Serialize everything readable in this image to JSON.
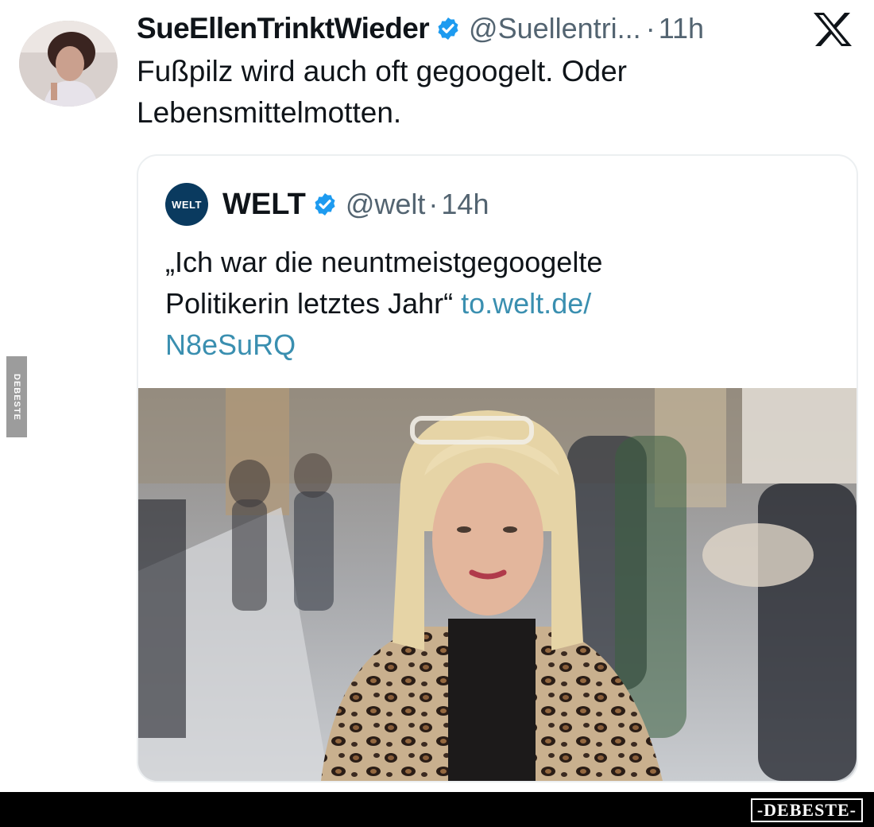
{
  "tweet": {
    "author_name": "SueEllenTrinktWieder",
    "handle": "@Suellentri...",
    "separator": "·",
    "time": "11h",
    "text_line1": "Fußpilz wird auch oft gegoogelt. Oder",
    "text_line2": "Lebensmittelmotten.",
    "avatar_icon": "profile-photo",
    "platform_icon": "x-logo-icon"
  },
  "quote": {
    "logo_text": "WELT",
    "author_name": "WELT",
    "handle": "@welt",
    "separator": "·",
    "time": "14h",
    "text_line1": "„Ich war die neuntmeistgegoogelte",
    "text_line2_plain": "Politikerin letztes Jahr“ ",
    "link_part1": "to.welt.de/",
    "link_part2": "N8eSuRQ",
    "image_icon": "article-photo"
  },
  "watermark": {
    "side_label": "DEBESTE",
    "footer_label": "-DEBESTE-"
  },
  "colors": {
    "verified": "#1d9bf0",
    "secondary_text": "#536471",
    "link": "#3a8fb0",
    "welt_logo_bg": "#0a3a5f"
  }
}
